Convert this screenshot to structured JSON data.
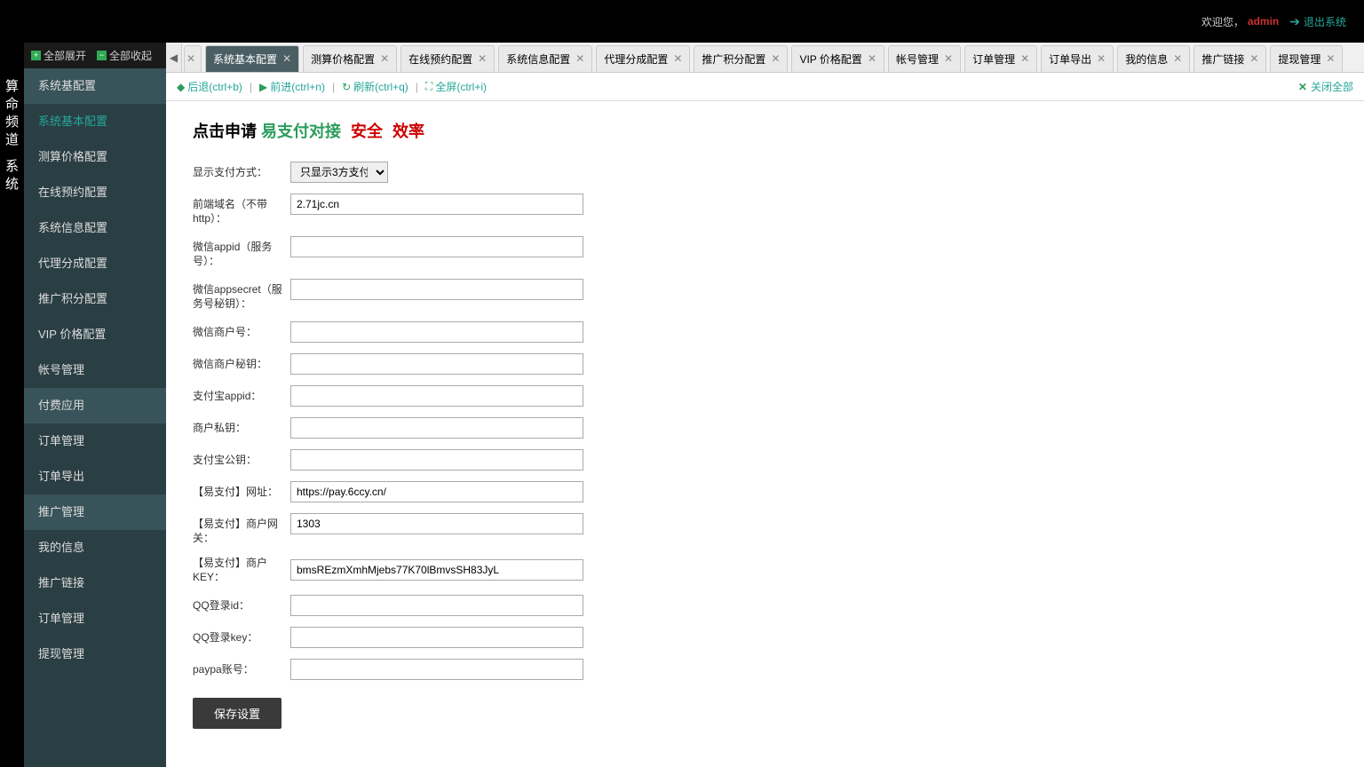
{
  "header": {
    "welcome": "欢迎您，",
    "username": "admin",
    "logout": "退出系统"
  },
  "left_col": {
    "section1": "算命频道",
    "section2": "系统"
  },
  "sidebar_top": {
    "expand_all": "全部展开",
    "collapse_all": "全部收起"
  },
  "sidebar": [
    {
      "label": "系统基配置",
      "type": "group"
    },
    {
      "label": "系统基本配置",
      "type": "selected"
    },
    {
      "label": "测算价格配置",
      "type": "normal"
    },
    {
      "label": "在线预约配置",
      "type": "normal"
    },
    {
      "label": "系统信息配置",
      "type": "normal"
    },
    {
      "label": "代理分成配置",
      "type": "normal"
    },
    {
      "label": "推广积分配置",
      "type": "normal"
    },
    {
      "label": "VIP 价格配置",
      "type": "normal"
    },
    {
      "label": "帐号管理",
      "type": "normal"
    },
    {
      "label": "付费应用",
      "type": "group"
    },
    {
      "label": "订单管理",
      "type": "normal"
    },
    {
      "label": "订单导出",
      "type": "normal"
    },
    {
      "label": "推广管理",
      "type": "group"
    },
    {
      "label": "我的信息",
      "type": "normal"
    },
    {
      "label": "推广链接",
      "type": "normal"
    },
    {
      "label": "订单管理",
      "type": "normal"
    },
    {
      "label": "提现管理",
      "type": "normal"
    }
  ],
  "tabs": [
    {
      "label": "系统基本配置",
      "active": true
    },
    {
      "label": "测算价格配置"
    },
    {
      "label": "在线预约配置"
    },
    {
      "label": "系统信息配置"
    },
    {
      "label": "代理分成配置"
    },
    {
      "label": "推广积分配置"
    },
    {
      "label": "VIP 价格配置"
    },
    {
      "label": "帐号管理"
    },
    {
      "label": "订单管理"
    },
    {
      "label": "订单导出"
    },
    {
      "label": "我的信息"
    },
    {
      "label": "推广链接"
    },
    {
      "label": "提现管理"
    }
  ],
  "toolbar": {
    "back": "后退(ctrl+b)",
    "forward": "前进(ctrl+n)",
    "refresh": "刷新(ctrl+q)",
    "fullscreen": "全屏(ctrl+i)",
    "close_all": "关闭全部"
  },
  "heading": {
    "t1": "点击申请",
    "t2": "易支付对接",
    "t3": "安全",
    "t4": "效率"
  },
  "form": {
    "display_pay_label": "显示支付方式：",
    "select_options": [
      "只显示3方支付"
    ],
    "select_value": "只显示3方支付",
    "frontend_domain_label": "前端域名（不带http）：",
    "frontend_domain_value": "2.71jc.cn",
    "wechat_appid_label": "微信appid（服务号）：",
    "wechat_appid_value": "",
    "wechat_appsecret_label": "微信appsecret（服务号秘钥）：",
    "wechat_appsecret_value": "",
    "wechat_mch_label": "微信商户号：",
    "wechat_mch_value": "",
    "wechat_mch_key_label": "微信商户秘钥：",
    "wechat_mch_key_value": "",
    "alipay_appid_label": "支付宝appid：",
    "alipay_appid_value": "",
    "mch_private_key_label": "商户私钥：",
    "mch_private_key_value": "",
    "alipay_pubkey_label": "支付宝公钥：",
    "alipay_pubkey_value": "",
    "epay_url_label": "【易支付】网址：",
    "epay_url_value": "https://pay.6ccy.cn/",
    "epay_gateway_label": "【易支付】商户网关：",
    "epay_gateway_value": "1303",
    "epay_key_label": "【易支付】商户KEY：",
    "epay_key_value": "bmsREzmXmhMjebs77K70lBmvsSH83JyL",
    "qq_login_id_label": "QQ登录id：",
    "qq_login_id_value": "",
    "qq_login_key_label": "QQ登录key：",
    "qq_login_key_value": "",
    "paypal_label": "paypa账号：",
    "paypal_value": "",
    "save_button": "保存设置"
  }
}
